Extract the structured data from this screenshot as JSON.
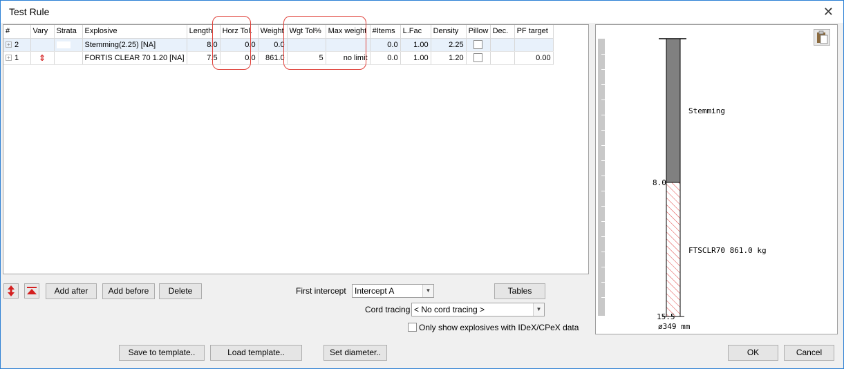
{
  "window": {
    "title": "Test Rule",
    "close_glyph": "✕"
  },
  "grid": {
    "columns": [
      "#",
      "Vary",
      "Strata",
      "Explosive",
      "Length",
      "Horz Tol.",
      "Weight",
      "Wgt Tol%",
      "Max weight",
      "#Items",
      "L.Fac",
      "Density",
      "Pillow",
      "Dec.",
      "PF target"
    ],
    "rows": [
      {
        "num": "2",
        "vary": "",
        "explosive": "Stemming(2.25) [NA]",
        "length": "8.0",
        "horz_tol": "0.0",
        "weight": "0.0",
        "wgt_tol": "",
        "max_weight": "",
        "items": "0.0",
        "lfac": "1.00",
        "density": "2.25",
        "pf_target": ""
      },
      {
        "num": "1",
        "vary": "⇕",
        "explosive": "FORTIS CLEAR 70 1.20 [NA]",
        "length": "7.5",
        "horz_tol": "0.0",
        "weight": "861.0",
        "wgt_tol": "5",
        "max_weight": "no limit",
        "items": "0.0",
        "lfac": "1.00",
        "density": "1.20",
        "pf_target": "0.00"
      }
    ]
  },
  "toolbar": {
    "add_after": "Add after",
    "add_before": "Add before",
    "delete": "Delete",
    "tables": "Tables"
  },
  "first_intercept": {
    "label": "First intercept",
    "value": "Intercept A"
  },
  "cord_tracing": {
    "label": "Cord tracing",
    "value": "< No cord tracing >"
  },
  "only_show": {
    "label": "Only show explosives with IDeX/CPeX data",
    "checked": false
  },
  "footer": {
    "save_template": "Save to template..",
    "load_template": "Load template..",
    "set_diameter": "Set diameter..",
    "ok": "OK",
    "cancel": "Cancel"
  },
  "diagram": {
    "stemming_label": "Stemming",
    "explosive_label": "FTSCLR70 861.0 kg",
    "depth_mid": "8.0",
    "depth_bottom": "15.5",
    "diameter": "ø349 mm",
    "stemming_color": "#808080",
    "explosive_hatch_color": "#e04040"
  }
}
